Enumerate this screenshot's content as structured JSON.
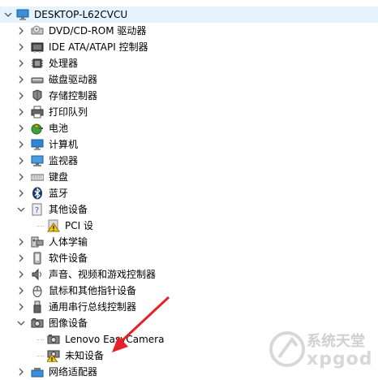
{
  "tree": {
    "root": {
      "label": "DESKTOP-L62CVCU",
      "icon": "computer-monitor-icon",
      "expanded": true
    },
    "categories": [
      {
        "label": "DVD/CD-ROM 驱动器",
        "icon": "cd-drive-icon",
        "expanded": false
      },
      {
        "label": "IDE ATA/ATAPI 控制器",
        "icon": "ide-controller-icon",
        "expanded": false
      },
      {
        "label": "处理器",
        "icon": "processor-icon",
        "expanded": false
      },
      {
        "label": "磁盘驱动器",
        "icon": "disk-drive-icon",
        "expanded": false
      },
      {
        "label": "存储控制器",
        "icon": "storage-controller-icon",
        "expanded": false
      },
      {
        "label": "打印队列",
        "icon": "printer-icon",
        "expanded": false
      },
      {
        "label": "电池",
        "icon": "battery-icon",
        "expanded": false
      },
      {
        "label": "计算机",
        "icon": "computer-icon",
        "expanded": false
      },
      {
        "label": "监视器",
        "icon": "monitor-icon",
        "expanded": false
      },
      {
        "label": "键盘",
        "icon": "keyboard-icon",
        "expanded": false
      },
      {
        "label": "蓝牙",
        "icon": "bluetooth-icon",
        "expanded": false
      },
      {
        "label": "其他设备",
        "icon": "other-devices-icon",
        "expanded": true,
        "children": [
          {
            "label": "PCI 设",
            "icon": "warning-device-icon"
          }
        ]
      },
      {
        "label": "人体学输",
        "icon": "hid-icon",
        "expanded": false
      },
      {
        "label": "软件设备",
        "icon": "software-device-icon",
        "expanded": false
      },
      {
        "label": "声音、视频和游戏控制器",
        "icon": "sound-icon",
        "expanded": false
      },
      {
        "label": "鼠标和其他指针设备",
        "icon": "mouse-icon",
        "expanded": false
      },
      {
        "label": "通用串行总线控制器",
        "icon": "usb-icon",
        "expanded": false
      },
      {
        "label": "图像设备",
        "icon": "camera-icon",
        "expanded": true,
        "children": [
          {
            "label": "Lenovo EasyCamera",
            "icon": "camera-icon"
          },
          {
            "label": "未知设备",
            "icon": "warning-camera-icon"
          }
        ]
      },
      {
        "label": "网络适配器",
        "icon": "network-adapter-icon",
        "expanded": false
      }
    ]
  },
  "watermark": {
    "text": "系统天堂",
    "subtext": "xpgod"
  },
  "colors": {
    "selection": "#e5f3ff",
    "annotation_arrow": "#e8202a",
    "warning": "#f2c511"
  }
}
